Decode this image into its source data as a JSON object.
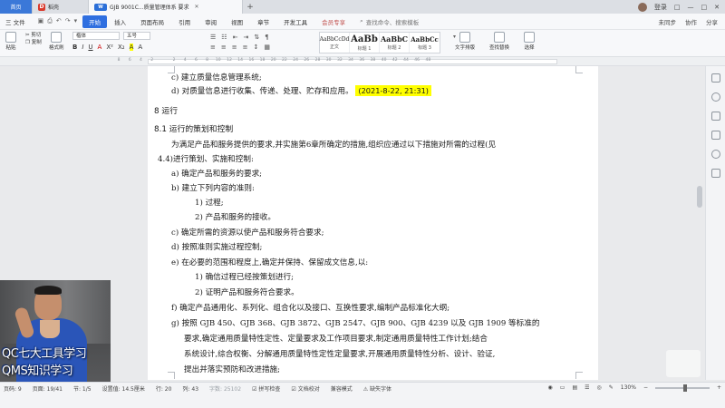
{
  "window": {
    "tabs": [
      {
        "label": "首页"
      },
      {
        "label": "稻壳"
      },
      {
        "label": "GJB 9001C...质量管理体系 要求"
      }
    ],
    "doc_tab_badge": "W",
    "right_items": [
      "登录",
      "□",
      "—",
      "□",
      "✕"
    ]
  },
  "menu": {
    "file": "三 文件",
    "items": [
      "开始",
      "插入",
      "页面布局",
      "引用",
      "审阅",
      "视图",
      "章节",
      "开发工具",
      "会员专享"
    ],
    "active": "开始",
    "search": "查找命令、搜索模板",
    "right": [
      "未同步",
      "协作",
      "分享"
    ]
  },
  "ribbon": {
    "paste": "粘贴",
    "cut": "剪切",
    "copy": "复制",
    "format_painter": "格式刷",
    "font_name": "楷体",
    "font_size": "五号",
    "styles": [
      {
        "sample": "AaBbCcDd",
        "name": "正文"
      },
      {
        "sample": "AaBb",
        "name": "标题 1"
      },
      {
        "sample": "AaBbC",
        "name": "标题 2"
      },
      {
        "sample": "AaBbCc",
        "name": "标题 3"
      }
    ],
    "text_layout": "文字排版",
    "find_replace": "查找替换",
    "select": "选择"
  },
  "ruler": {
    "ticks": [
      "8",
      "6",
      "4",
      "2",
      "",
      "2",
      "4",
      "6",
      "8",
      "10",
      "12",
      "14",
      "16",
      "18",
      "20",
      "22",
      "24",
      "26",
      "28",
      "30",
      "32",
      "34",
      "36",
      "38",
      "40",
      "42",
      "44",
      "46",
      "48"
    ]
  },
  "document": {
    "line_d_prefix": "d)",
    "line_d_text": "对质量信息进行收集、传递、处理、贮存和应用。",
    "line_d_highlight": "(2021-8-22, 21:31)",
    "line_e_prefix": "c)",
    "line_e_text": "建立质量信息管理系统;",
    "heading_8": "8  运行",
    "heading_81": "8.1  运行的策划和控制",
    "para_1": "为满足产品和服务提供的要求,并实施第6章所确定的措施,组织应通过以下措施对所需的过程(见",
    "para_2": "4.4)进行策划、实施和控制:",
    "items": [
      {
        "prefix": "a)",
        "text": "确定产品和服务的要求;"
      },
      {
        "prefix": "b)",
        "text": "建立下列内容的准则:"
      },
      {
        "prefix": "1)",
        "text": "过程;"
      },
      {
        "prefix": "2)",
        "text": "产品和服务的接收。"
      },
      {
        "prefix": "c)",
        "text": "确定所需的资源以使产品和服务符合要求;"
      },
      {
        "prefix": "d)",
        "text": "按照准则实施过程控制;"
      },
      {
        "prefix": "e)",
        "text": "在必要的范围和程度上,确定并保持、保留成文信息,以:"
      },
      {
        "prefix": "1)",
        "text": "确信过程已经按策划进行;"
      },
      {
        "prefix": "2)",
        "text": "证明产品和服务符合要求。"
      },
      {
        "prefix": "f)",
        "text": "确定产品通用化、系列化、组合化以及接口、互换性要求,编制产品标准化大纲;"
      },
      {
        "prefix": "g)",
        "text": "按照 GJB 450、GJB 368、GJB 3872、GJB 2547、GJB 900、GJB 4239 以及 GJB 1909 等标准的"
      }
    ],
    "g_cont_1": "要求,确定通用质量特性定性、定量要求及工作项目要求,制定通用质量特性工作计划;结合",
    "g_cont_2": "系统设计,综合权衡、分解通用质量特性定性定量要求,开展通用质量特性分析、设计、验证,",
    "g_cont_3": "提出并落实预防和改进措施;"
  },
  "overlay": {
    "caption_1": "QC七大工具学习",
    "caption_2": "QMS知识学习"
  },
  "status": {
    "page": "页码: 9",
    "pages": "页面: 19/41",
    "section": "节: 1/5",
    "setting": "设置值: 14.5厘米",
    "row": "行: 20",
    "col": "列: 43",
    "words": "字数: 25102",
    "spell": "拼写检查",
    "doc_check": "文档校对",
    "compat": "兼容模式",
    "missing_font": "缺失字体",
    "zoom": "130%",
    "zoom_fraction": 0.56
  },
  "colors": {
    "accent": "#2f6fe0",
    "highlight": "#ffff00",
    "caption": "#ffffff"
  }
}
